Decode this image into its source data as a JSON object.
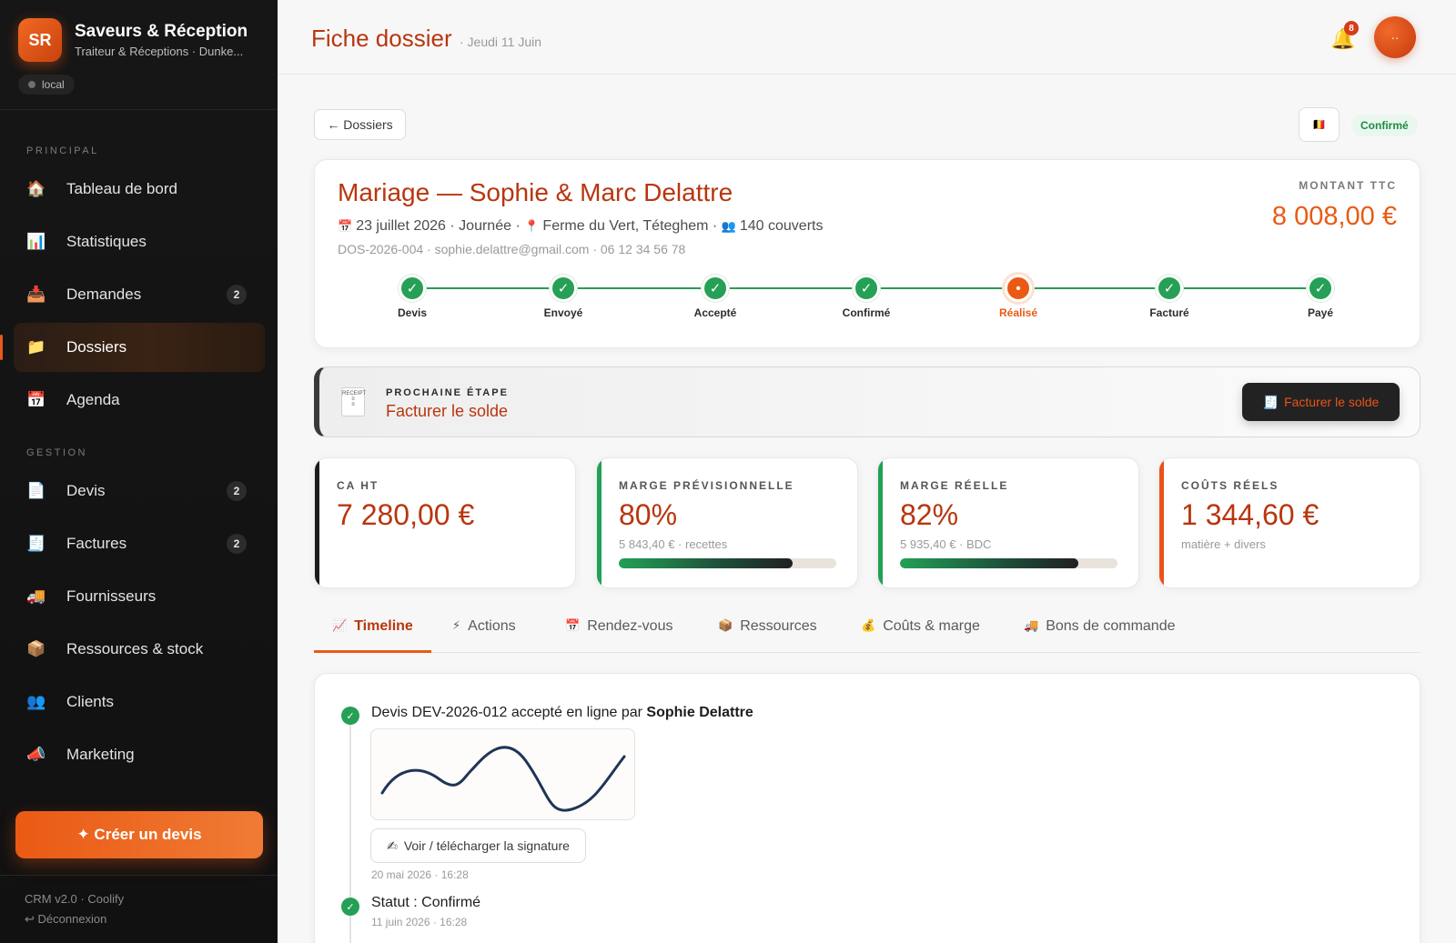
{
  "brand": {
    "logo": "SR",
    "name": "Saveurs & Réception",
    "subtitle": "Traiteur & Réceptions · Dunke...",
    "env": "local"
  },
  "sidebar": {
    "section_principal": "PRINCIPAL",
    "section_gestion": "GESTION",
    "items": [
      {
        "label": "Tableau de bord",
        "icon": "house-icon",
        "glyph": "🏠"
      },
      {
        "label": "Statistiques",
        "icon": "bar-chart-icon",
        "glyph": "📊"
      },
      {
        "label": "Demandes",
        "icon": "inbox-icon",
        "glyph": "📥",
        "badge": "2"
      },
      {
        "label": "Dossiers",
        "icon": "folder-icon",
        "glyph": "📁",
        "active": true
      },
      {
        "label": "Agenda",
        "icon": "calendar-icon",
        "glyph": "📅"
      },
      {
        "label": "Devis",
        "icon": "document-icon",
        "glyph": "📄",
        "badge": "2"
      },
      {
        "label": "Factures",
        "icon": "receipt-icon",
        "glyph": "🧾",
        "badge": "2"
      },
      {
        "label": "Fournisseurs",
        "icon": "truck-icon",
        "glyph": "🚚"
      },
      {
        "label": "Ressources & stock",
        "icon": "box-icon",
        "glyph": "📦"
      },
      {
        "label": "Clients",
        "icon": "people-icon",
        "glyph": "👥"
      },
      {
        "label": "Marketing",
        "icon": "megaphone-icon",
        "glyph": "📣"
      }
    ],
    "create_button": "✦ Créer un devis",
    "footer_version": "CRM v2.0 · Coolify",
    "footer_logout": "↩ Déconnexion"
  },
  "header": {
    "title": "Fiche dossier",
    "date": "· Jeudi 11 Juin",
    "notif_count": "8",
    "avatar_text": "··"
  },
  "toolbar": {
    "back_label": "← Dossiers",
    "flag_glyph": "🇧🇪",
    "status": "Confirmé"
  },
  "dossier": {
    "title": "Mariage — Sophie & Marc Delattre",
    "date": "23 juillet 2026",
    "period": "Journée",
    "location": "Ferme du Vert, Téteghem",
    "guests": "140 couverts",
    "contact": "DOS-2026-004 · sophie.delattre@gmail.com · 06 12 34 56 78",
    "amount_label": "MONTANT TTC",
    "amount": "8 008,00 €"
  },
  "steps": [
    {
      "label": "Devis",
      "state": "done"
    },
    {
      "label": "Envoyé",
      "state": "done"
    },
    {
      "label": "Accepté",
      "state": "done"
    },
    {
      "label": "Confirmé",
      "state": "done"
    },
    {
      "label": "Réalisé",
      "state": "current"
    },
    {
      "label": "Facturé",
      "state": "done"
    },
    {
      "label": "Payé",
      "state": "done"
    }
  ],
  "next_step": {
    "label": "PROCHAINE ÉTAPE",
    "action": "Facturer le solde",
    "button": "Facturer le solde",
    "receipt_text": "RECEIPT"
  },
  "kpis": [
    {
      "label": "CA HT",
      "value": "7 280,00 €",
      "sub": "",
      "accent": "#1b1b1b"
    },
    {
      "label": "MARGE PRÉVISIONNELLE",
      "value": "80%",
      "sub": "5 843,40 € · recettes",
      "accent": "#22a055",
      "progress": 0.8
    },
    {
      "label": "MARGE RÉELLE",
      "value": "82%",
      "sub": "5 935,40 € · BDC",
      "accent": "#22a055",
      "progress": 0.82
    },
    {
      "label": "COÛTS RÉELS",
      "value": "1 344,60 €",
      "sub": "matière + divers",
      "accent": "#e8541a"
    }
  ],
  "tabs": [
    {
      "label": "Timeline",
      "icon": "chart-icon",
      "glyph": "📈",
      "active": true
    },
    {
      "label": "Actions",
      "icon": "lightning-icon",
      "glyph": "⚡"
    },
    {
      "label": "Rendez-vous",
      "icon": "calendar-icon",
      "glyph": "📅"
    },
    {
      "label": "Ressources",
      "icon": "box-icon",
      "glyph": "📦"
    },
    {
      "label": "Coûts & marge",
      "icon": "money-bag-icon",
      "glyph": "💰"
    },
    {
      "label": "Bons de commande",
      "icon": "truck-icon",
      "glyph": "🚚"
    }
  ],
  "timeline": [
    {
      "title_prefix": "Devis DEV-2026-012 accepté en ligne par ",
      "title_bold": "Sophie Delattre",
      "signature_button": "Voir / télécharger la signature",
      "date": "20 mai 2026 · 16:28"
    },
    {
      "title_prefix": "Statut : Confirmé",
      "date": "11 juin 2026 · 16:28"
    }
  ],
  "colors": {
    "accent": "#ea5a14",
    "brand_red": "#b8360f",
    "success": "#26a056",
    "sidebar": "#141414"
  }
}
